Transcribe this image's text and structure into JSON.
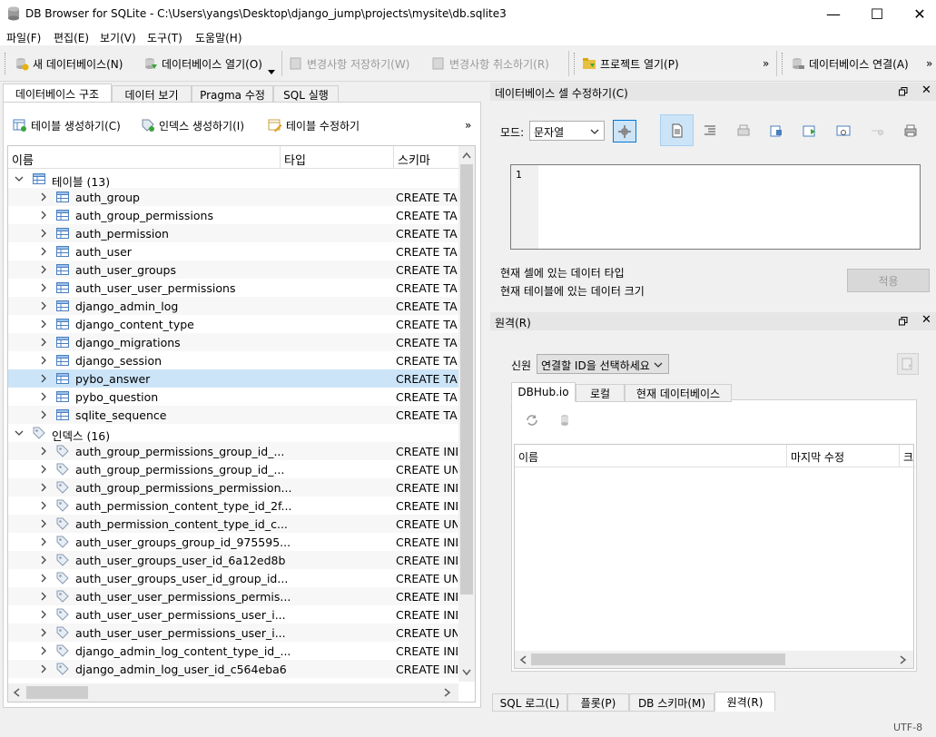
{
  "window": {
    "title": "DB Browser for SQLite - C:\\Users\\yangs\\Desktop\\django_jump\\projects\\mysite\\db.sqlite3",
    "minimize": "—",
    "maximize": "☐",
    "close": "✕"
  },
  "menu": [
    "파일(F)",
    "편집(E)",
    "보기(V)",
    "도구(T)",
    "도움말(H)"
  ],
  "toolbar": {
    "new_db": "새 데이터베이스(N)",
    "open_db": "데이터베이스 열기(O)",
    "write_changes": "변경사항 저장하기(W)",
    "revert_changes": "변경사항 취소하기(R)",
    "open_project": "프로젝트 열기(P)",
    "overflow": "»",
    "attach_db": "데이터베이스 연결(A)",
    "overflow2": "»"
  },
  "main_tabs": [
    "데이터베이스 구조",
    "데이터 보기",
    "Pragma 수정",
    "SQL 실행"
  ],
  "structure_toolbar": {
    "create_table": "테이블 생성하기(C)",
    "create_index": "인덱스 생성하기(I)",
    "modify_table": "테이블 수정하기",
    "overflow": "»"
  },
  "tree": {
    "columns": [
      "이름",
      "타입",
      "스키마"
    ],
    "tables_label": "테이블 (13)",
    "tables": [
      {
        "name": "auth_group",
        "schema": "CREATE TA"
      },
      {
        "name": "auth_group_permissions",
        "schema": "CREATE TA"
      },
      {
        "name": "auth_permission",
        "schema": "CREATE TA"
      },
      {
        "name": "auth_user",
        "schema": "CREATE TA"
      },
      {
        "name": "auth_user_groups",
        "schema": "CREATE TA"
      },
      {
        "name": "auth_user_user_permissions",
        "schema": "CREATE TA"
      },
      {
        "name": "django_admin_log",
        "schema": "CREATE TA"
      },
      {
        "name": "django_content_type",
        "schema": "CREATE TA"
      },
      {
        "name": "django_migrations",
        "schema": "CREATE TA"
      },
      {
        "name": "django_session",
        "schema": "CREATE TA"
      },
      {
        "name": "pybo_answer",
        "schema": "CREATE TA"
      },
      {
        "name": "pybo_question",
        "schema": "CREATE TA"
      },
      {
        "name": "sqlite_sequence",
        "schema": "CREATE TA"
      }
    ],
    "indices_label": "인덱스 (16)",
    "indices": [
      {
        "name": "auth_group_permissions_group_id_...",
        "schema": "CREATE IND"
      },
      {
        "name": "auth_group_permissions_group_id_...",
        "schema": "CREATE UN"
      },
      {
        "name": "auth_group_permissions_permission...",
        "schema": "CREATE IND"
      },
      {
        "name": "auth_permission_content_type_id_2f...",
        "schema": "CREATE IND"
      },
      {
        "name": "auth_permission_content_type_id_c...",
        "schema": "CREATE UN"
      },
      {
        "name": "auth_user_groups_group_id_975595...",
        "schema": "CREATE IND"
      },
      {
        "name": "auth_user_groups_user_id_6a12ed8b",
        "schema": "CREATE IND"
      },
      {
        "name": "auth_user_groups_user_id_group_id...",
        "schema": "CREATE UN"
      },
      {
        "name": "auth_user_user_permissions_permis...",
        "schema": "CREATE IND"
      },
      {
        "name": "auth_user_user_permissions_user_i...",
        "schema": "CREATE IND"
      },
      {
        "name": "auth_user_user_permissions_user_i...",
        "schema": "CREATE UN"
      },
      {
        "name": "django_admin_log_content_type_id_...",
        "schema": "CREATE IND"
      },
      {
        "name": "django_admin_log_user_id_c564eba6",
        "schema": "CREATE IND"
      }
    ]
  },
  "edit_cell": {
    "title": "데이터베이스 셀 수정하기(C)",
    "mode_label": "모드:",
    "mode_value": "문자열",
    "line_number": "1",
    "type_label": "현재 셀에 있는 데이터 타입",
    "size_label": "현재 테이블에 있는 데이터 크기",
    "apply": "적용"
  },
  "remote": {
    "title": "원격(R)",
    "identity_label": "신원",
    "identity_value": "연결할 ID을 선택하세요",
    "tabs": [
      "DBHub.io",
      "로컬",
      "현재 데이터베이스"
    ],
    "columns": [
      "이름",
      "마지막 수정",
      "크"
    ]
  },
  "bottom_tabs": [
    "SQL 로그(L)",
    "플롯(P)",
    "DB 스키마(M)",
    "원격(R)"
  ],
  "status": {
    "encoding": "UTF-8"
  },
  "colors": {
    "selection": "#cce4f7",
    "accent": "#0078d7"
  }
}
